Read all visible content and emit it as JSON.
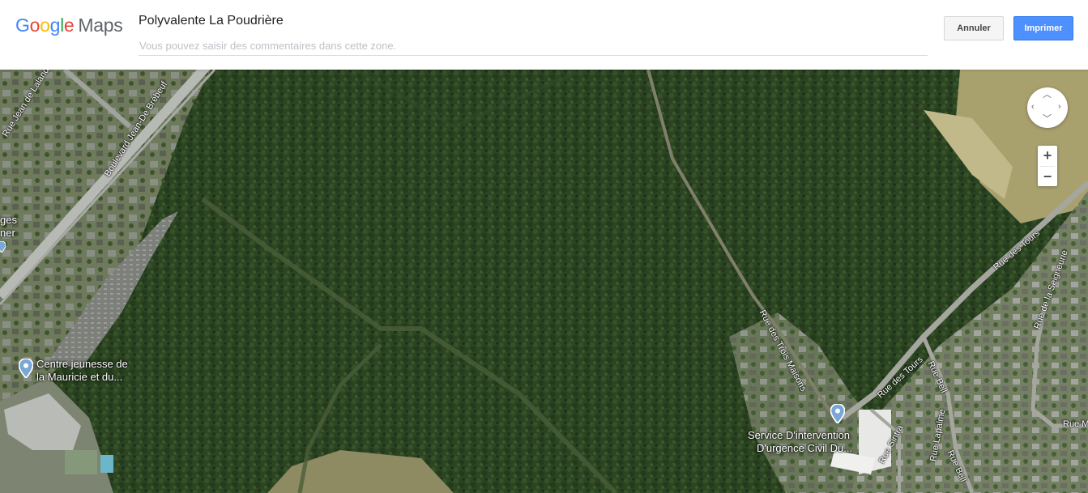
{
  "header": {
    "logo": {
      "google_letters": [
        "G",
        "o",
        "o",
        "g",
        "l",
        "e"
      ],
      "maps": "Maps"
    },
    "title": "Polyvalente La Poudrière",
    "comment_placeholder": "Vous pouvez saisir des commentaires dans cette zone.",
    "cancel_label": "Annuler",
    "print_label": "Imprimer"
  },
  "map": {
    "mode": "satellite",
    "roads": [
      {
        "name": "Rue Jean de Lalande"
      },
      {
        "name": "Boulevard Jean-De Brébeuf"
      },
      {
        "name": "Rue des Trois Maisons"
      },
      {
        "name": "Rue des Tours"
      },
      {
        "name": "Rue des Tours"
      },
      {
        "name": "Rue de la Seigneurie"
      },
      {
        "name": "Rue Bell"
      },
      {
        "name": "Rue Bell"
      },
      {
        "name": "Rue Sintra"
      },
      {
        "name": "Rue Lapalme"
      },
      {
        "name": "Rue M"
      }
    ],
    "poi_partial": [
      "ges",
      "ner"
    ],
    "pois": [
      {
        "name_line1": "Centre jeunesse de",
        "name_line2": "la Mauricie et du..."
      },
      {
        "name_line1": "Service D'intervention",
        "name_line2": "D'urgence Civil Du..."
      }
    ],
    "controls": {
      "zoom_in": "+",
      "zoom_out": "−"
    }
  }
}
